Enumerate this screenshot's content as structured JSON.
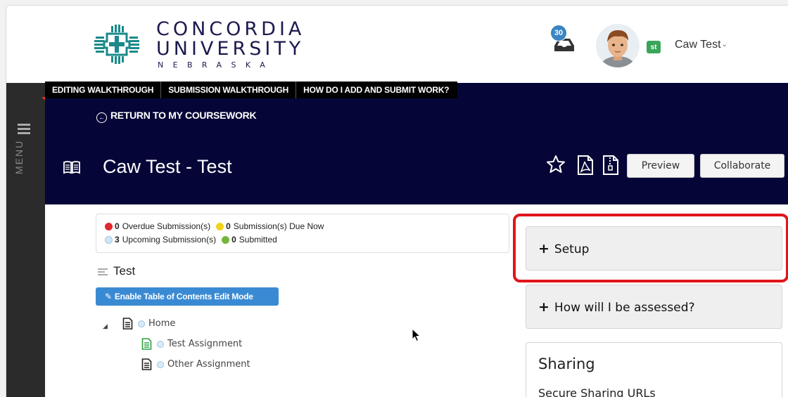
{
  "header": {
    "logo": {
      "line1": "CONCORDIA",
      "line2": "UNIVERSITY",
      "line3": "NEBRASKA"
    },
    "notification_count": "30",
    "user_badge": "st",
    "user_name": "Caw Test",
    "user_chevron": "⌄"
  },
  "sidebar": {
    "menu_label": "MENU"
  },
  "tabs": [
    {
      "label": "EDITING WALKTHROUGH"
    },
    {
      "label": "SUBMISSION WALKTHROUGH"
    },
    {
      "label": "HOW DO I ADD AND SUBMIT WORK?"
    }
  ],
  "banner": {
    "return_label": "RETURN TO MY COURSEWORK",
    "course_title": "Caw Test - Test",
    "preview_label": "Preview",
    "collaborate_label": "Collaborate"
  },
  "status": {
    "overdue_count": "0",
    "overdue_label": "Overdue Submission(s)",
    "due_now_count": "0",
    "due_now_label": "Submission(s) Due Now",
    "upcoming_count": "3",
    "upcoming_label": "Upcoming Submission(s)",
    "submitted_count": "0",
    "submitted_label": "Submitted",
    "colors": {
      "overdue": "#e0282e",
      "due_now": "#f2d21b",
      "upcoming": "#cfe6f7",
      "submitted": "#76b53c"
    }
  },
  "toc": {
    "title": "Test",
    "enable_button": "Enable Table of Contents Edit Mode",
    "items": [
      {
        "label": "Home"
      },
      {
        "label": "Test Assignment"
      },
      {
        "label": "Other Assignment"
      }
    ]
  },
  "panels": {
    "setup_label": "Setup",
    "assessed_label": "How will I be assessed?",
    "plus": "+",
    "sharing_title": "Sharing",
    "sharing_sub": "Secure Sharing URLs"
  },
  "colors": {
    "banner": "#050637",
    "highlight": "#e0161c",
    "primary_button": "#3a8ad3"
  }
}
